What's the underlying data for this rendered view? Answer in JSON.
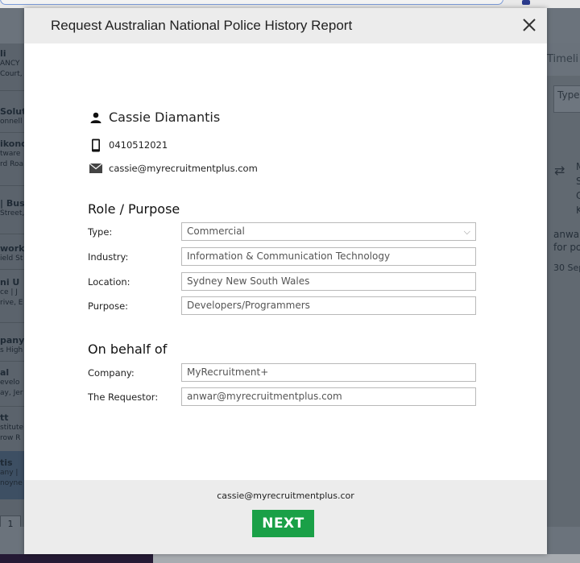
{
  "modal": {
    "title": "Request Australian National Police History Report"
  },
  "candidate": {
    "name": "Cassie Diamantis",
    "phone": "0410512021",
    "email": "cassie@myrecruitmentplus.com"
  },
  "role_purpose": {
    "heading": "Role / Purpose",
    "type_label": "Type:",
    "type_value": "Commercial",
    "industry_label": "Industry:",
    "industry_value": "Information & Communication Technology",
    "location_label": "Location:",
    "location_value": "Sydney New South Wales",
    "purpose_label": "Purpose:",
    "purpose_value": "Developers/Programmers"
  },
  "on_behalf": {
    "heading": "On behalf of",
    "company_label": "Company:",
    "company_value": "MyRecruitment+",
    "requestor_label": "The Requestor:",
    "requestor_value": "anwar@myrecruitmentplus.com"
  },
  "footer": {
    "email": "cassie@myrecruitmentplus.cor",
    "next_label": "NEXT"
  },
  "background": {
    "left_items": [
      {
        "line1": "li",
        "line2": "ANCY",
        "line3": "Court,"
      },
      {
        "line1": "Solut",
        "line2": "onnell"
      },
      {
        "line1": "ikond",
        "line2": "tware",
        "line3": "rd Roa"
      },
      {
        "line1": "| Bus",
        "line2": "Street,"
      },
      {
        "line1": "work |",
        "line2": "ield St"
      },
      {
        "line1": "ni U",
        "line2": "ce | J",
        "line3": "rive, E"
      },
      {
        "line1": "pany |",
        "line2": "s High"
      },
      {
        "line1": "al",
        "line2": "evelo",
        "line3": "ay, Jer"
      },
      {
        "line1": "tt",
        "line2": "stitute",
        "line3": "row R"
      },
      {
        "line1": "tis",
        "line2": "any |",
        "line3": "noyne"
      }
    ],
    "page_number": "1",
    "right_tab": "Timeli",
    "right_input": "Type",
    "right_lines": [
      "M",
      "S",
      "C",
      "K"
    ],
    "right_text1": "anwa",
    "right_text2": "for po",
    "right_date": "30 Sep"
  },
  "colors": {
    "next_button": "#1aa047",
    "header_bg": "#ececec"
  }
}
